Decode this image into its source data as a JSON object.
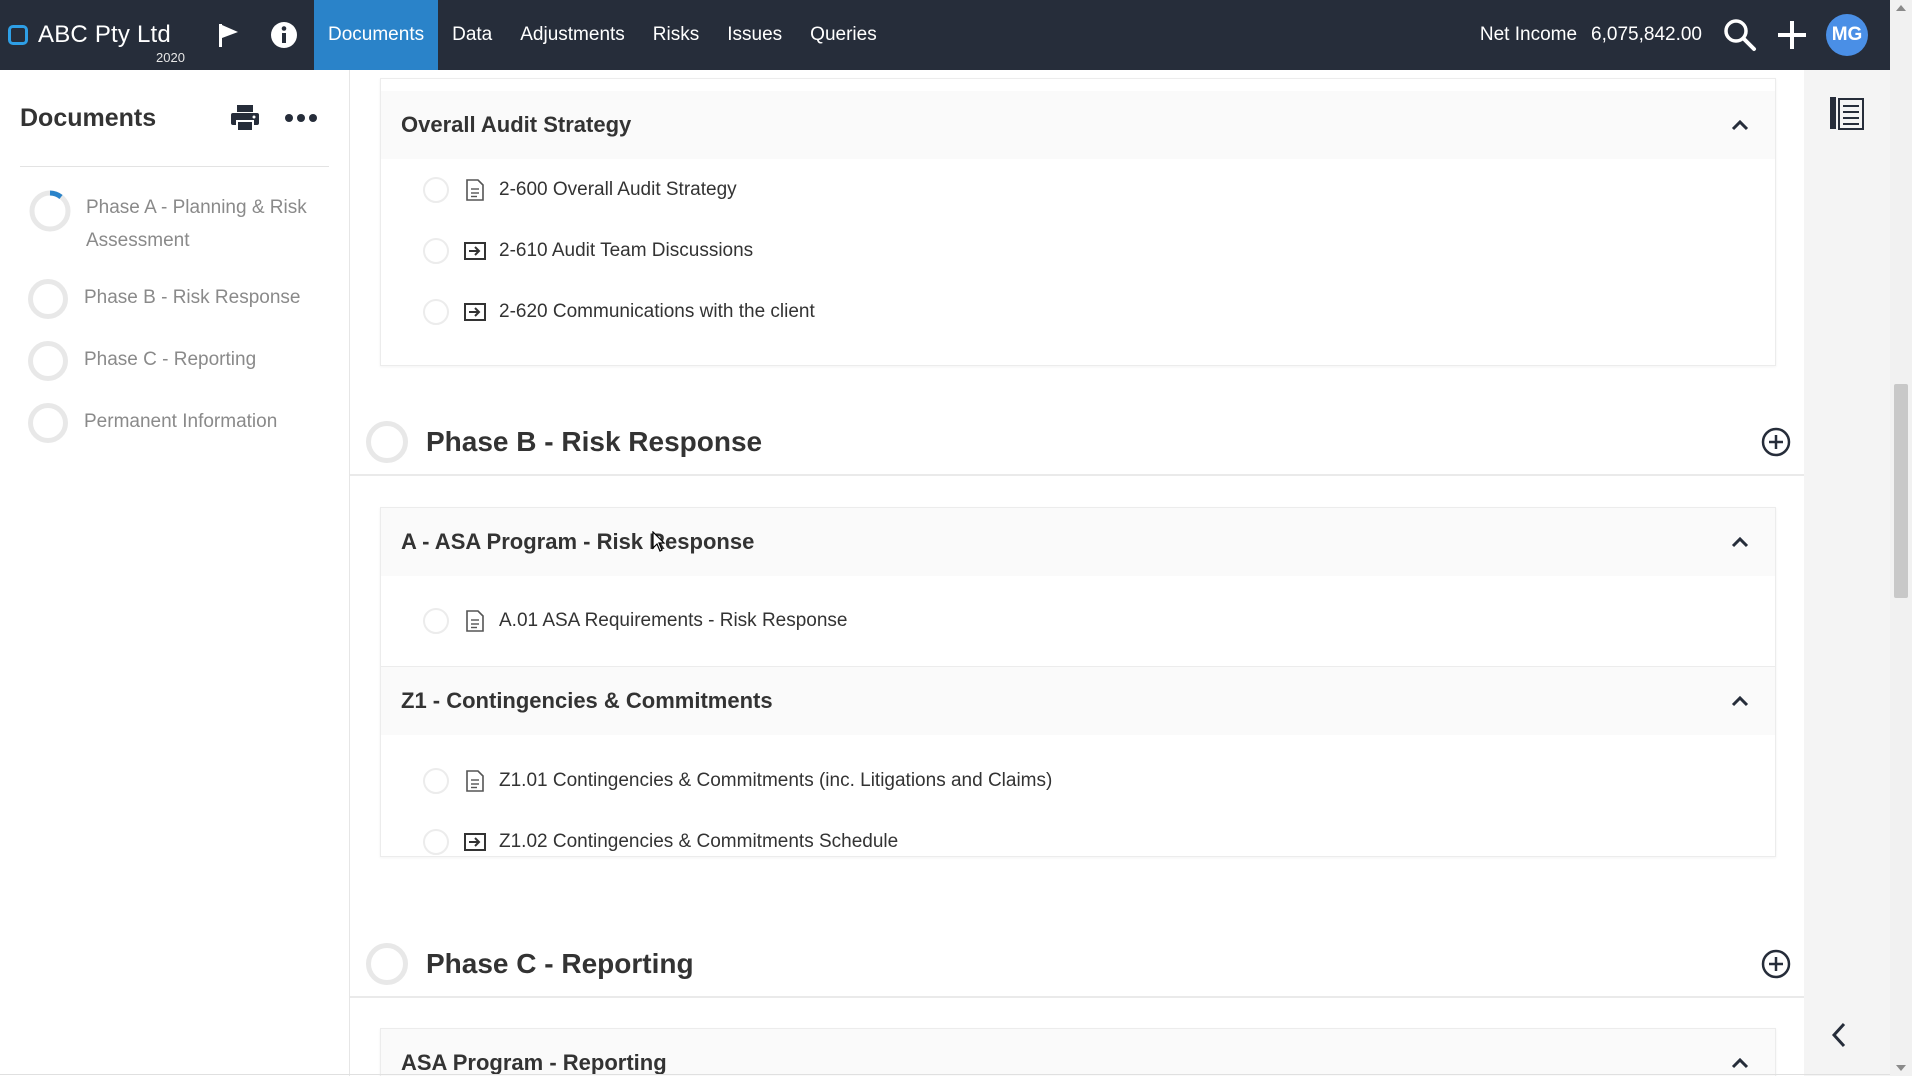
{
  "header": {
    "company": "ABC Pty Ltd",
    "year": "2020",
    "nav": [
      {
        "label": "Documents",
        "active": true
      },
      {
        "label": "Data"
      },
      {
        "label": "Adjustments"
      },
      {
        "label": "Risks"
      },
      {
        "label": "Issues"
      },
      {
        "label": "Queries"
      }
    ],
    "net_income_label": "Net Income",
    "net_income_value": "6,075,842.00",
    "avatar_initials": "MG"
  },
  "sidebar": {
    "title": "Documents",
    "phases": [
      {
        "label": "Phase A - Planning & Risk Assessment",
        "progress": 0.1
      },
      {
        "label": "Phase B - Risk Response",
        "progress": 0
      },
      {
        "label": "Phase C - Reporting",
        "progress": 0
      },
      {
        "label": "Permanent Information",
        "progress": 0
      }
    ]
  },
  "main": {
    "card_a": {
      "title": "Overall Audit Strategy",
      "docs": [
        {
          "label": "2-600 Overall Audit Strategy",
          "icon": "document-icon"
        },
        {
          "label": "2-610 Audit Team Discussions",
          "icon": "link-document-icon"
        },
        {
          "label": "2-620 Communications with the client",
          "icon": "link-document-icon"
        }
      ]
    },
    "phase_b": {
      "title": "Phase B - Risk Response",
      "groups": [
        {
          "title": "A - ASA Program - Risk Response",
          "docs": [
            {
              "label": "A.01 ASA Requirements - Risk Response",
              "icon": "document-icon"
            }
          ]
        },
        {
          "title": "Z1 - Contingencies & Commitments",
          "docs": [
            {
              "label": "Z1.01 Contingencies & Commitments (inc. Litigations and Claims)",
              "icon": "document-icon"
            },
            {
              "label": "Z1.02 Contingencies & Commitments Schedule",
              "icon": "link-document-icon"
            }
          ]
        }
      ]
    },
    "phase_c": {
      "title": "Phase C - Reporting",
      "groups": [
        {
          "title": "ASA Program - Reporting"
        }
      ]
    }
  },
  "colors": {
    "topbar": "#262d3a",
    "active_tab": "#2a83c9",
    "avatar": "#4a8fe6",
    "progress": "#2a83c9"
  }
}
